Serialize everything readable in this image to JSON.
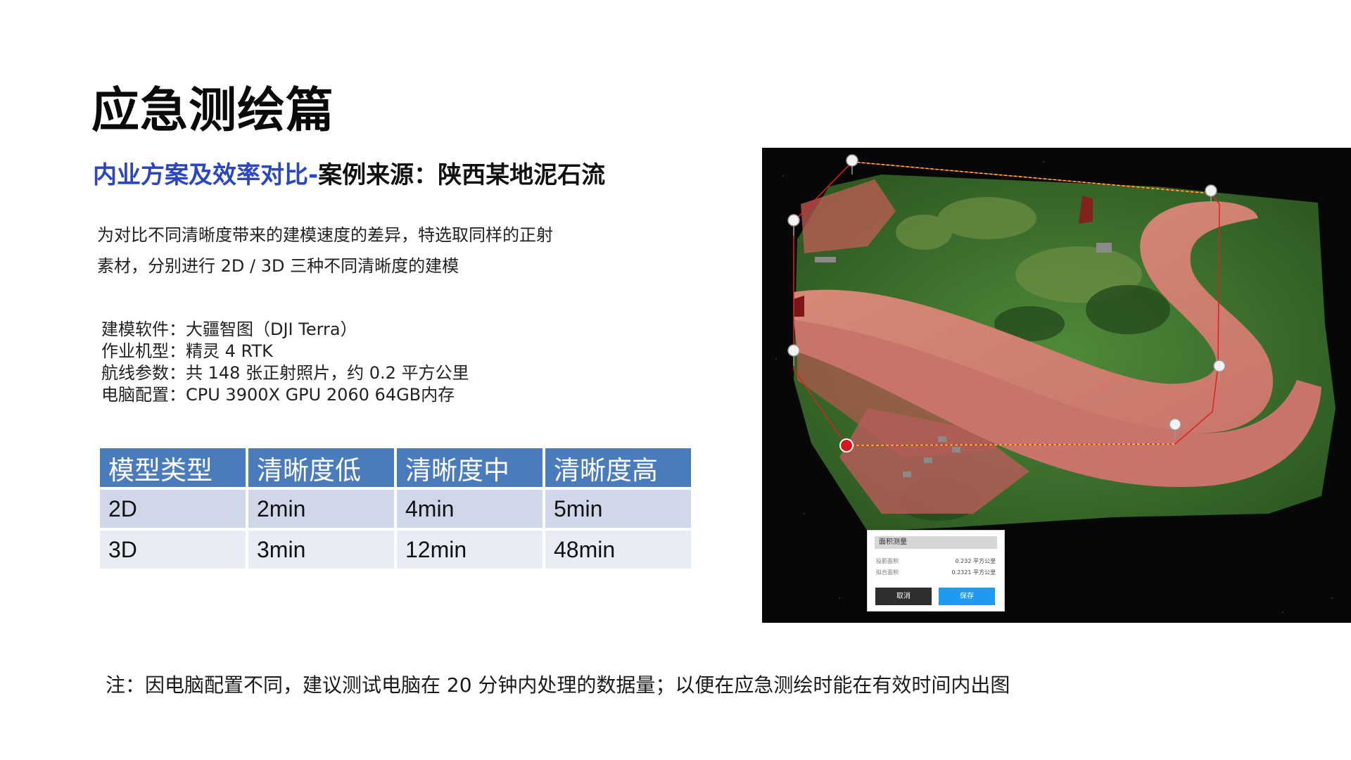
{
  "title": "应急测绘篇",
  "subtitle": {
    "blue": "内业方案及效率对比-",
    "black": "案例来源：陕西某地泥石流"
  },
  "intro": [
    "为对比不同清晰度带来的建模速度的差异，特选取同样的正射",
    "素材，分别进行 2D / 3D 三种不同清晰度的建模"
  ],
  "specs": [
    "建模软件：大疆智图（DJI Terra）",
    "作业机型：精灵 4 RTK",
    "航线参数：共 148 张正射照片，约 0.2 平方公里",
    "电脑配置：CPU 3900X GPU 2060 64GB内存"
  ],
  "table": {
    "headers": [
      "模型类型",
      "清晰度低",
      "清晰度中",
      "清晰度高"
    ],
    "rows": [
      [
        "2D",
        "2min",
        "4min",
        "5min"
      ],
      [
        "3D",
        "3min",
        "12min",
        "48min"
      ]
    ]
  },
  "note": "注：因电脑配置不同，建议测试电脑在 20 分钟内处理的数据量；以便在应急测绘时能在有效时间内出图",
  "map_dialog": {
    "title": "面积测量",
    "rows": [
      {
        "label": "投影面积",
        "value": "0.232 平方公里"
      },
      {
        "label": "拟合面积",
        "value": "0.2321 平方公里"
      }
    ],
    "cancel": "取消",
    "save": "保存"
  },
  "colors": {
    "title_blue": "#2a46c4",
    "table_header": "#4a7bbd",
    "row_odd": "#cfd7e8",
    "row_even": "#e8ecf4",
    "save_button": "#1e9bf0"
  }
}
